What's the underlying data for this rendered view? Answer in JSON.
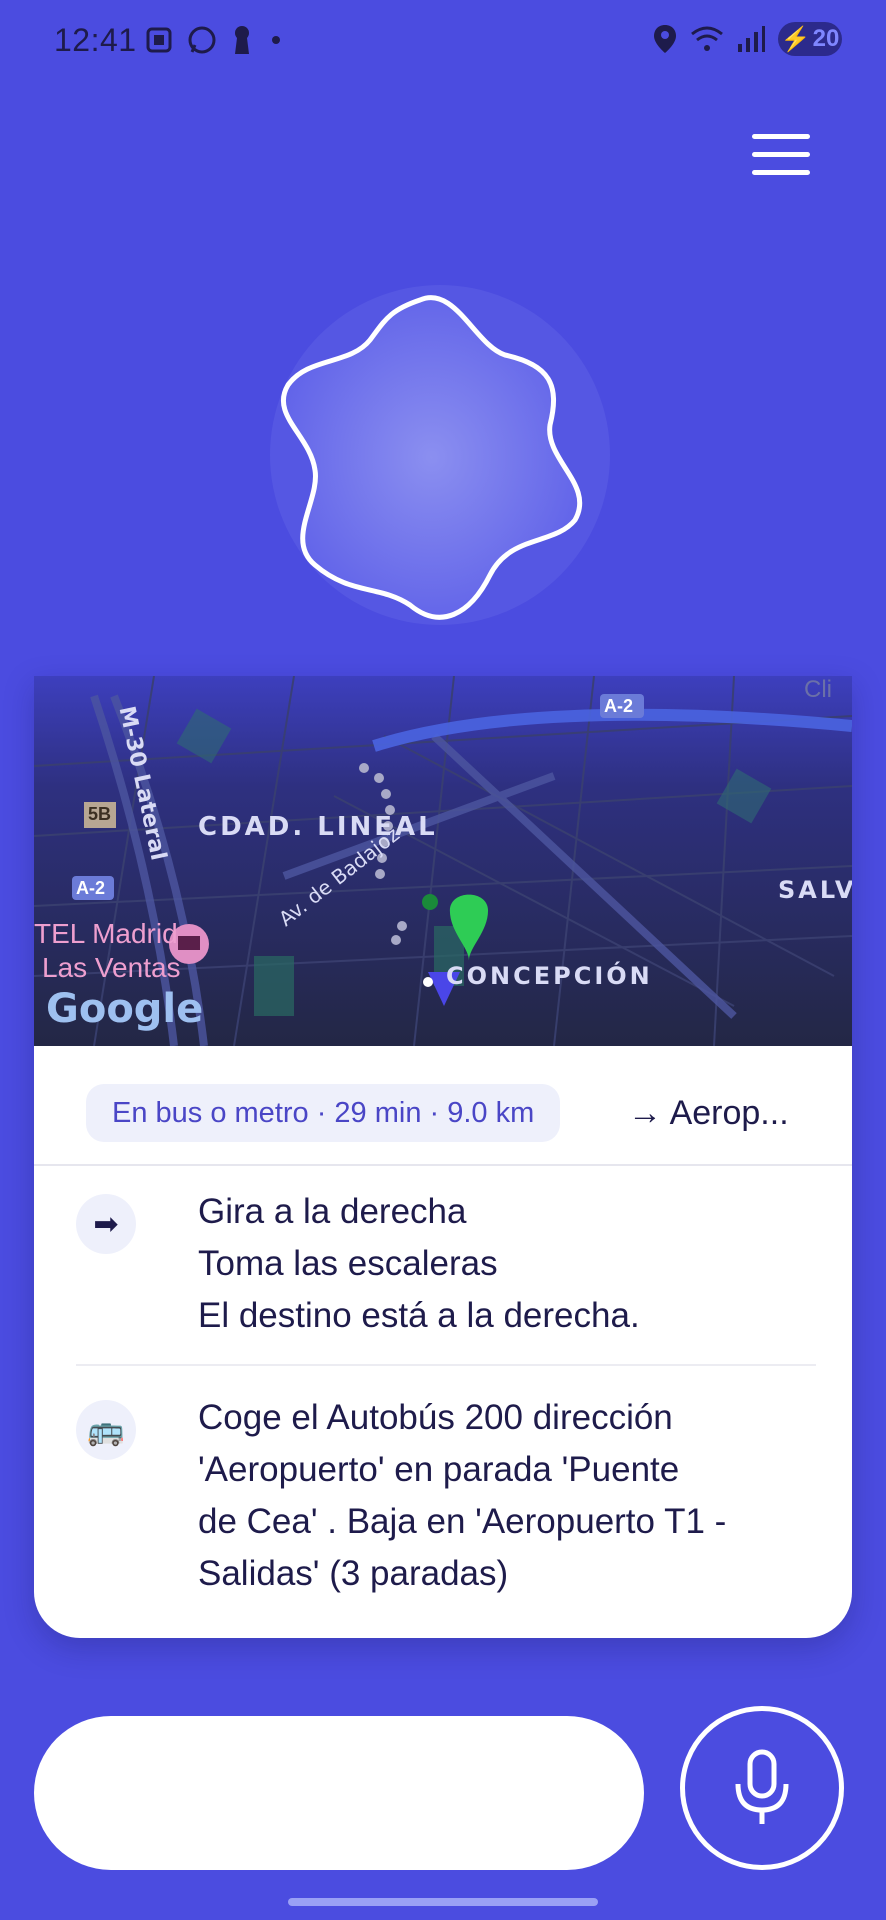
{
  "status_bar": {
    "time": "12:41",
    "battery": "20"
  },
  "map": {
    "labels": {
      "lineal": "CDAD. LINEAL",
      "concepcion": "CONCEPCIÓN",
      "salva": "SALVA",
      "badajoz": "Av. de Badajoz",
      "lateral": "M-30 Lateral",
      "hotel_line1": "TEL Madrid",
      "hotel_line2": "Las Ventas",
      "a2_left": "A-2",
      "a2_top": "A-2",
      "exit": "5B",
      "google": "Google",
      "cli": "Cli"
    }
  },
  "route": {
    "summary": "En bus o metro · 29 min · 9.0 km",
    "destination": "→ Aerop..."
  },
  "steps": [
    {
      "icon": "➡",
      "lines": [
        "Gira a la derecha",
        "Toma las escaleras",
        "El destino está a la derecha."
      ]
    },
    {
      "icon": "🚌",
      "lines": [
        "Coge el Autobús 200 dirección",
        "'Aeropuerto' en parada 'Puente",
        "de Cea' . Baja en 'Aeropuerto T1 -",
        "Salidas' (3 paradas)"
      ]
    }
  ],
  "input": {
    "value": "",
    "placeholder": ""
  },
  "colors": {
    "background": "#4b4ce0",
    "text": "#1e1b4b",
    "accent": "#4a46c6",
    "pin_green": "#2ecc55"
  }
}
